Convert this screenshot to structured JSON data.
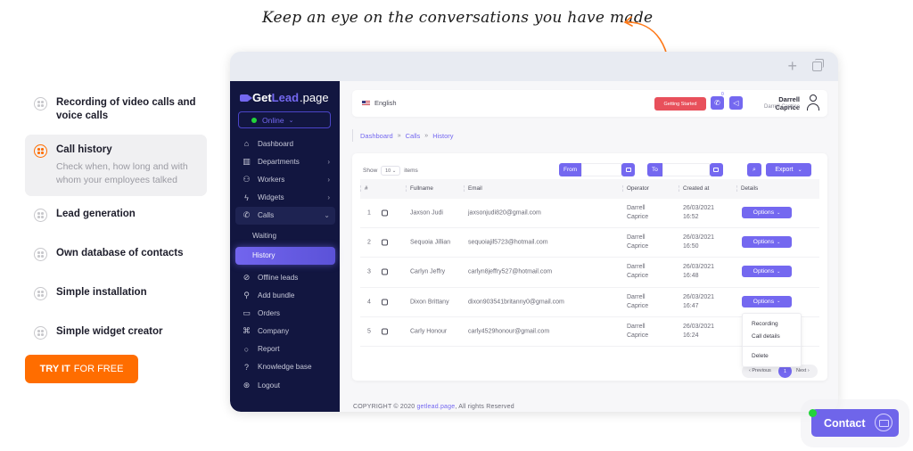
{
  "headline": "Keep an eye on the conversations you have made",
  "colors": {
    "accent": "#7468f0",
    "orange": "#ff6d00",
    "sidebar": "#121640",
    "danger": "#e8505b",
    "online": "#22d43a"
  },
  "features": [
    {
      "title": "Recording of video calls and voice calls",
      "icon": "grip-dots-icon",
      "active": false
    },
    {
      "title": "Call history",
      "description": "Check when, how long and with whom your employees talked",
      "icon": "grip-dots-icon",
      "active": true
    },
    {
      "title": "Lead generation",
      "icon": "grip-dots-icon",
      "active": false
    },
    {
      "title": "Own database of contacts",
      "icon": "grip-dots-icon",
      "active": false
    },
    {
      "title": "Simple installation",
      "icon": "grip-dots-icon",
      "active": false
    },
    {
      "title": "Simple widget creator",
      "icon": "grip-dots-icon",
      "active": false
    }
  ],
  "cta": {
    "bold": "TRY IT",
    "rest": "FOR FREE"
  },
  "app": {
    "logo": {
      "get": "Get",
      "lead": "Lead",
      "page": ".page"
    },
    "status": "Online",
    "nav": [
      {
        "label": "Dashboard",
        "icon": "home-icon"
      },
      {
        "label": "Departments",
        "icon": "building-icon",
        "arrow": "›"
      },
      {
        "label": "Workers",
        "icon": "users-icon",
        "arrow": "›"
      },
      {
        "label": "Widgets",
        "icon": "bolt-icon",
        "arrow": "›"
      },
      {
        "label": "Calls",
        "icon": "phone-icon",
        "arrow": "⌄"
      }
    ],
    "calls_sub": [
      "Waiting",
      "History"
    ],
    "nav_bottom": [
      {
        "label": "Offline leads",
        "icon": "offline-icon"
      },
      {
        "label": "Add bundle",
        "icon": "user-plus-icon"
      },
      {
        "label": "Orders",
        "icon": "card-icon"
      },
      {
        "label": "Company",
        "icon": "command-icon"
      },
      {
        "label": "Report",
        "icon": "chat-icon"
      },
      {
        "label": "Knowledge base",
        "icon": "help-icon"
      },
      {
        "label": "Logout",
        "icon": "logout-icon"
      }
    ],
    "topbar": {
      "language": "English",
      "getting_started": "Getting Started",
      "call_badge": "0",
      "user_name": "Darrell Caprice",
      "user_sub": "Darrell Caprice"
    },
    "breadcrumb": [
      "Dashboard",
      "Calls",
      "History"
    ],
    "breadcrumb_sep": "»",
    "table_controls": {
      "show_label": "Show",
      "page_size": "10",
      "items_label": "items",
      "from_label": "From",
      "to_label": "To",
      "export_label": "Export"
    },
    "columns": [
      "#",
      "Fullname",
      "Email",
      "Operator",
      "Created at",
      "Details"
    ],
    "rows": [
      {
        "num": "1",
        "name": "Jaxson Judi",
        "email": "jaxsonjudi820@gmail.com",
        "op1": "Darrell",
        "op2": "Caprice",
        "date": "26/03/2021",
        "time": "16:52"
      },
      {
        "num": "2",
        "name": "Sequoia Jillian",
        "email": "sequoiajil5723@hotmail.com",
        "op1": "Darrell",
        "op2": "Caprice",
        "date": "26/03/2021",
        "time": "16:50"
      },
      {
        "num": "3",
        "name": "Carlyn Jeffry",
        "email": "carlyn8jeffry527@hotmail.com",
        "op1": "Darrell",
        "op2": "Caprice",
        "date": "26/03/2021",
        "time": "16:48"
      },
      {
        "num": "4",
        "name": "Dixon Brittany",
        "email": "dixon903541britanny0@gmail.com",
        "op1": "Darrell",
        "op2": "Caprice",
        "date": "26/03/2021",
        "time": "16:47"
      },
      {
        "num": "5",
        "name": "Carly Honour",
        "email": "carly4529honour@gmail.com",
        "op1": "Darrell",
        "op2": "Caprice",
        "date": "26/03/2021",
        "time": "16:24"
      }
    ],
    "options_label": "Options",
    "dropdown": [
      "Recording",
      "Call details",
      "Delete"
    ],
    "pager": {
      "prev": "‹ Previous",
      "current": "1",
      "next": "Next ›"
    },
    "copyright": {
      "pre": "COPYRIGHT © 2020 ",
      "link": "getlead.page",
      "post": ", All rights Reserved"
    }
  },
  "contact": {
    "label": "Contact"
  }
}
